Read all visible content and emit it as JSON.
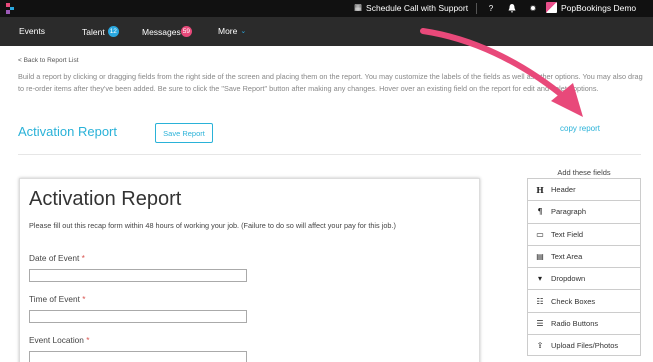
{
  "topbar": {
    "schedule_label": "Schedule Call with Support",
    "brand_name": "PopBookings Demo"
  },
  "nav": {
    "events": "Events",
    "talent": "Talent",
    "talent_count": "12",
    "messages": "Messages",
    "messages_count": "59",
    "more": "More"
  },
  "back_link": "< Back to Report List",
  "intro": "Build a report by clicking or dragging fields from the right side of the screen and placing them on the report. You may customize the labels of the fields as well as other options. You may also drag to re-order items after they've been added. Be sure to click the \"Save Report\" button after making any changes. Hover over an existing field on the report for edit and delete options.",
  "report_title": "Activation Report",
  "save_button": "Save Report",
  "copy_link": "copy report",
  "form": {
    "title": "Activation Report",
    "description": "Please fill out this recap form within 48 hours of working your job. (Failure to do so will affect your pay for this job.)",
    "fields": [
      {
        "label": "Date of Event",
        "required": "*"
      },
      {
        "label": "Time of Event",
        "required": "*"
      },
      {
        "label": "Event Location",
        "required": "*"
      }
    ]
  },
  "palette": {
    "title": "Add these fields",
    "items": [
      {
        "icon": "header-icon",
        "glyph": "H",
        "label": "Header"
      },
      {
        "icon": "paragraph-icon",
        "glyph": "¶",
        "label": "Paragraph"
      },
      {
        "icon": "text-field-icon",
        "glyph": "▭",
        "label": "Text Field"
      },
      {
        "icon": "text-area-icon",
        "glyph": "▤",
        "label": "Text Area"
      },
      {
        "icon": "dropdown-icon",
        "glyph": "▼",
        "label": "Dropdown"
      },
      {
        "icon": "checkboxes-icon",
        "glyph": "☑",
        "label": "Check Boxes"
      },
      {
        "icon": "radio-buttons-icon",
        "glyph": "◉",
        "label": "Radio Buttons"
      },
      {
        "icon": "upload-icon",
        "glyph": "⇪",
        "label": "Upload Files/Photos"
      }
    ]
  },
  "colors": {
    "accent": "#2ab2d8",
    "arrow": "#e8497a",
    "topbar": "#111111",
    "navbar": "#2b2b2b"
  }
}
